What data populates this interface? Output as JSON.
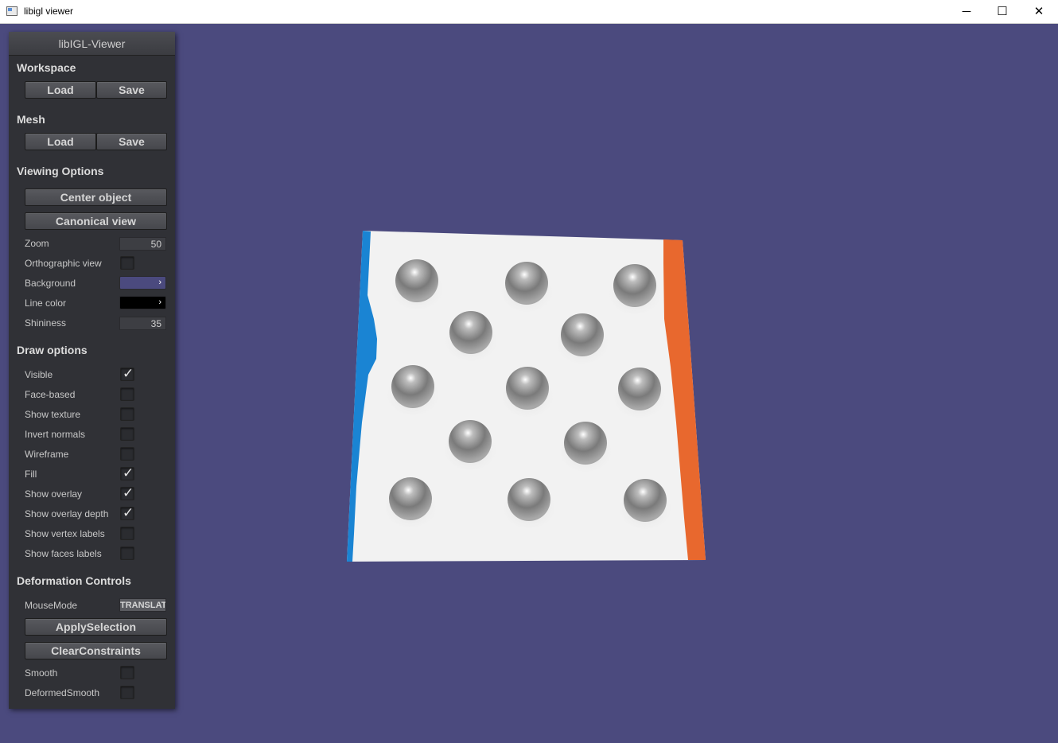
{
  "window": {
    "title": "libigl viewer",
    "minimize": "─",
    "maximize": "☐",
    "close": "✕"
  },
  "panel": {
    "title": "libIGL-Viewer",
    "workspace": {
      "heading": "Workspace",
      "load": "Load",
      "save": "Save"
    },
    "mesh": {
      "heading": "Mesh",
      "load": "Load",
      "save": "Save"
    },
    "viewing": {
      "heading": "Viewing Options",
      "center_object": "Center object",
      "canonical_view": "Canonical view",
      "zoom_label": "Zoom",
      "zoom_value": "50",
      "ortho_label": "Orthographic view",
      "ortho_checked": false,
      "background_label": "Background",
      "background_color": "#4b4a7e",
      "line_color_label": "Line color",
      "line_color": "#000000",
      "shininess_label": "Shininess",
      "shininess_value": "35"
    },
    "draw": {
      "heading": "Draw options",
      "items": [
        {
          "label": "Visible",
          "checked": true
        },
        {
          "label": "Face-based",
          "checked": false
        },
        {
          "label": "Show texture",
          "checked": false
        },
        {
          "label": "Invert normals",
          "checked": false
        },
        {
          "label": "Wireframe",
          "checked": false
        },
        {
          "label": "Fill",
          "checked": true
        },
        {
          "label": "Show overlay",
          "checked": true
        },
        {
          "label": "Show overlay depth",
          "checked": true
        },
        {
          "label": "Show vertex labels",
          "checked": false
        },
        {
          "label": "Show faces labels",
          "checked": false
        }
      ]
    },
    "deformation": {
      "heading": "Deformation Controls",
      "mousemode_label": "MouseMode",
      "mousemode_value": "TRANSLATE",
      "apply_selection": "ApplySelection",
      "clear_constraints": "ClearConstraints",
      "smooth_label": "Smooth",
      "smooth_checked": false,
      "deformed_smooth_label": "DeformedSmooth",
      "deformed_smooth_checked": false
    }
  },
  "icons": {
    "check": "✓",
    "combo_arrow": "›"
  },
  "scene": {
    "mesh_color": "#f2f2f2",
    "left_constraint_color": "#1a84d3",
    "right_constraint_color": "#e8682e",
    "bump_color": "#6e6e6e"
  }
}
